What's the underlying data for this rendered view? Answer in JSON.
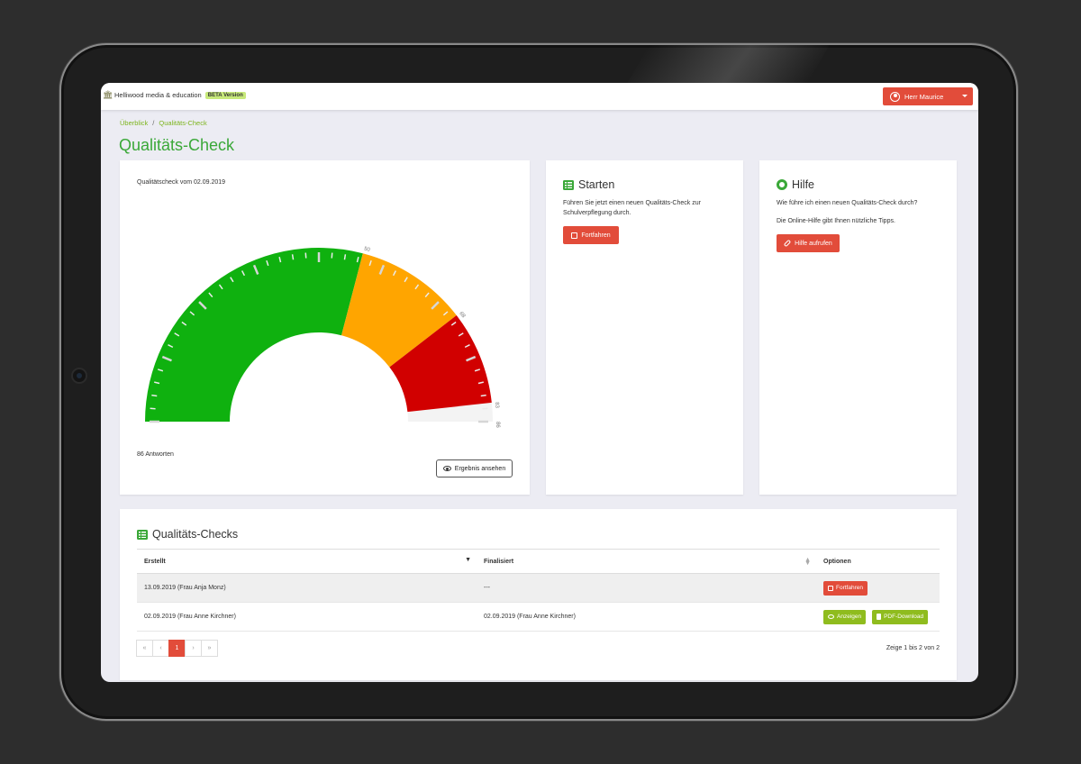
{
  "topbar": {
    "brand": "Helliwood media & education",
    "beta_badge": "BETA Version",
    "user_label": "Herr Maurice"
  },
  "breadcrumb": [
    "Überblick",
    "Qualitäts-Check"
  ],
  "page_title": "Qualitäts-Check",
  "gauge": {
    "label": "Qualitätscheck vom 02.09.2019",
    "answers": "86 Antworten",
    "button": "Ergebnis ansehen",
    "colors": {
      "green": "#0fb10f",
      "orange": "#ffa500",
      "red": "#d10000"
    }
  },
  "chart_data": {
    "type": "gauge",
    "min": 0,
    "max": 86,
    "bands": [
      {
        "from": 0,
        "to": 50,
        "color": "#0fb10f"
      },
      {
        "from": 50,
        "to": 68,
        "color": "#ffa500"
      },
      {
        "from": 68,
        "to": 83,
        "color": "#d10000"
      }
    ],
    "tick_labels": [
      "50",
      "68",
      "83",
      "86"
    ]
  },
  "start_card": {
    "title": "Starten",
    "text": "Führen Sie jetzt einen neuen Qualitäts-Check zur Schulverpflegung durch.",
    "button": "Fortfahren"
  },
  "help_card": {
    "title": "Hilfe",
    "text1": "Wie führe ich einen neuen Qualitäts-Check durch?",
    "text2": "Die Online-Hilfe gibt Ihnen nützliche Tipps.",
    "button": "Hilfe aufrufen"
  },
  "table": {
    "title": "Qualitäts-Checks",
    "headers": [
      "Erstellt",
      "Finalisiert",
      "Optionen"
    ],
    "rows": [
      {
        "created": "13.09.2019 (Frau Anja Monz)",
        "finalized": "---",
        "actions": [
          "Fortfahren"
        ]
      },
      {
        "created": "02.09.2019 (Frau Anne Kirchner)",
        "finalized": "02.09.2019 (Frau Anne Kirchner)",
        "actions": [
          "Anzeigen",
          "PDF-Download"
        ]
      }
    ],
    "pagination": [
      "«",
      "‹",
      "1",
      "›",
      "»"
    ],
    "info": "Zeige 1 bis 2 von 2"
  }
}
